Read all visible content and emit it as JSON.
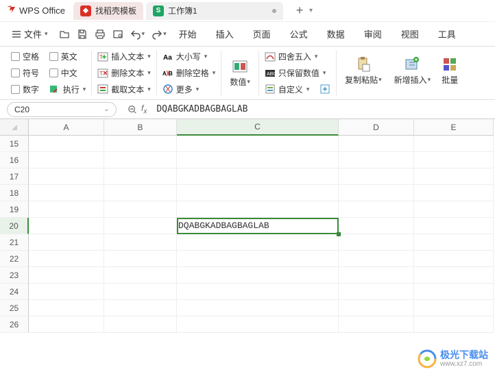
{
  "titlebar": {
    "app_name": "WPS Office",
    "tab_template": "找稻壳模板",
    "tab_workbook": "工作簿1"
  },
  "menubar": {
    "file": "文件",
    "tabs": [
      "开始",
      "插入",
      "页面",
      "公式",
      "数据",
      "审阅",
      "视图",
      "工具"
    ]
  },
  "ribbon": {
    "g1": {
      "space": "空格",
      "english": "英文",
      "symbol": "符号",
      "chinese": "中文",
      "number": "数字",
      "execute": "执行"
    },
    "g2": {
      "insert_text": "插入文本",
      "delete_text": "删除文本",
      "extract_text": "截取文本"
    },
    "g3": {
      "case": "大小写",
      "del_space": "删除空格",
      "more": "更多"
    },
    "g4": {
      "value": "数值"
    },
    "g5": {
      "round": "四舍五入",
      "keep_num": "只保留数值",
      "custom": "自定义"
    },
    "g6": {
      "copy_paste": "复制粘贴",
      "insert_new": "新增插入",
      "batch": "批量"
    }
  },
  "formula_bar": {
    "name": "C20",
    "value": "DQABGKADBAGBAGLAB"
  },
  "columns": [
    "A",
    "B",
    "C",
    "D",
    "E"
  ],
  "rows": [
    "15",
    "16",
    "17",
    "18",
    "19",
    "20",
    "21",
    "22",
    "23",
    "24",
    "25",
    "26"
  ],
  "active": {
    "row": "20",
    "col": "C"
  },
  "cells": {
    "c20": "DQABGKADBAGBAGLAB"
  },
  "watermark": {
    "zh": "极光下载站",
    "url": "www.xz7.com"
  }
}
